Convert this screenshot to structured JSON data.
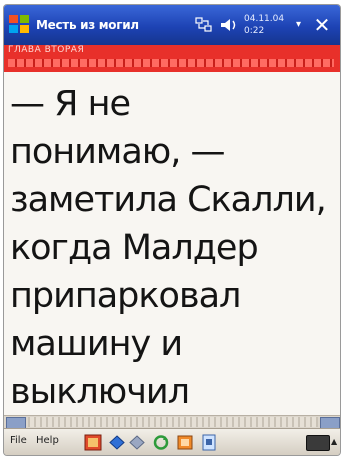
{
  "titlebar": {
    "title": "Месть из могил",
    "clock_date": "04.11.04",
    "clock_time": "0:22",
    "menu_arrow": "▾",
    "close_label": "✕",
    "icons": [
      "windows-start-icon",
      "network-icon",
      "volume-icon",
      "close-icon"
    ],
    "bg": "#1d43b4"
  },
  "header": {
    "label": "ГЛАВА ВТОРАЯ",
    "bg": "#e8302a"
  },
  "page": {
    "lines": [
      "   — Я не",
      "понимаю, —",
      "заметила Скалли,",
      "когда Малдер",
      "припарковал",
      "машину и",
      "выключил"
    ]
  },
  "toolbar": {
    "file_label": "File",
    "help_label": "Help",
    "icons": [
      "book-icon",
      "back-diamond-icon",
      "forward-diamond-icon",
      "refresh-icon",
      "bookmark-icon",
      "page-icon",
      "keyboard-icon"
    ]
  }
}
